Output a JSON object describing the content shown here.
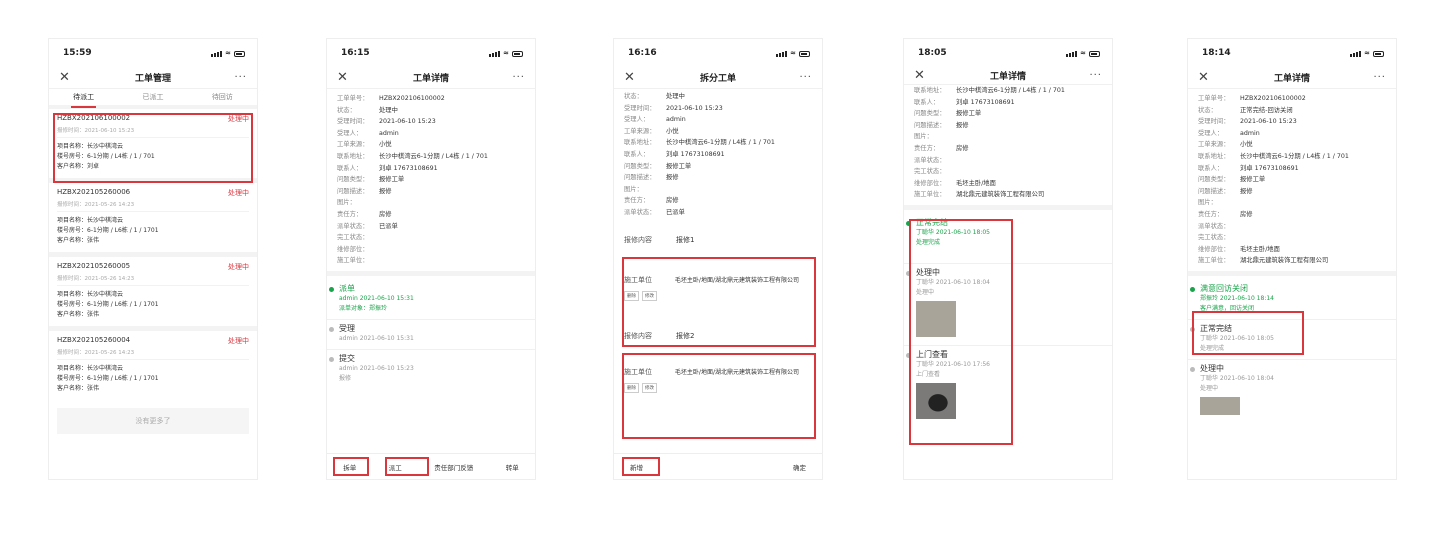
{
  "p1": {
    "time": "15:59",
    "title": "工单管理",
    "tabs": [
      "待派工",
      "已派工",
      "待回访"
    ],
    "cards": [
      {
        "no": "HZBX202106100002",
        "status": "处理中",
        "time": "报修时间：2021-06-10 15:23",
        "project": "项目名称：长沙中棋湾云",
        "room": "楼号房号：6-1分期 / L4栋 / 1 / 701",
        "customer": "客户名称：刘卓"
      },
      {
        "no": "HZBX202105260006",
        "status": "处理中",
        "time": "报修时间：2021-05-26 14:23",
        "project": "项目名称：长沙中棋湾云",
        "room": "楼号房号：6-1分期 / L6栋 / 1 / 1701",
        "customer": "客户名称：张伟"
      },
      {
        "no": "HZBX202105260005",
        "status": "处理中",
        "time": "报修时间：2021-05-26 14:23",
        "project": "项目名称：长沙中棋湾云",
        "room": "楼号房号：6-1分期 / L6栋 / 1 / 1701",
        "customer": "客户名称：张伟"
      },
      {
        "no": "HZBX202105260004",
        "status": "处理中",
        "time": "报修时间：2021-05-26 14:23",
        "project": "项目名称：长沙中棋湾云",
        "room": "楼号房号：6-1分期 / L6栋 / 1 / 1701",
        "customer": "客户名称：张伟"
      }
    ],
    "nomore": "没有更多了"
  },
  "p2": {
    "time": "16:15",
    "title": "工单详情",
    "fields": [
      [
        "工单单号：",
        "HZBX202106100002"
      ],
      [
        "状态：",
        "处理中"
      ],
      [
        "受理时间：",
        "2021-06-10 15:23"
      ],
      [
        "受理人：",
        "admin"
      ],
      [
        "工单来源：",
        "小悦"
      ],
      [
        "联系地址：",
        "长沙中棋湾云6-1分期 / L4栋 / 1 / 701"
      ],
      [
        "联系人：",
        "刘卓 17673108691"
      ],
      [
        "问题类型：",
        "报修工单"
      ],
      [
        "问题描述：",
        "报修"
      ],
      [
        "图片：",
        ""
      ],
      [
        "责任方：",
        "房修"
      ],
      [
        "派单状态：",
        "已派单"
      ],
      [
        "完工状态：",
        ""
      ],
      [
        "维修部位：",
        ""
      ],
      [
        "施工单位：",
        ""
      ]
    ],
    "timeline": [
      {
        "h": "派单",
        "s1": "admin 2021-06-10 15:31",
        "s2": "派单对象：郑振玲"
      },
      {
        "h": "受理",
        "s1": "admin 2021-06-10 15:31",
        "s2": ""
      },
      {
        "h": "提交",
        "s1": "admin 2021-06-10 15:23",
        "s2": "报修"
      }
    ],
    "buttons": [
      "拆单",
      "派工",
      "责任部门反馈",
      "转单"
    ]
  },
  "p3": {
    "time": "16:16",
    "title": "拆分工单",
    "fields": [
      [
        "状态：",
        "处理中"
      ],
      [
        "受理时间：",
        "2021-06-10 15:23"
      ],
      [
        "受理人：",
        "admin"
      ],
      [
        "工单来源：",
        "小悦"
      ],
      [
        "联系地址：",
        "长沙中棋湾云6-1分期 / L4栋 / 1 / 701"
      ],
      [
        "联系人：",
        "刘卓 17673108691"
      ],
      [
        "问题类型：",
        "报修工单"
      ],
      [
        "问题描述：",
        "报修"
      ],
      [
        "图片：",
        ""
      ],
      [
        "责任方：",
        "房修"
      ],
      [
        "派单状态：",
        "已派单"
      ]
    ],
    "blocks": [
      {
        "k1": "报修内容",
        "v1": "报修1",
        "k2": "施工单位",
        "v2": "毛坯主卧/地面/湖北鼎元建筑装饰工程有限公司"
      },
      {
        "k1": "报修内容",
        "v1": "报修2",
        "k2": "施工单位",
        "v2": "毛坯主卧/地面/湖北鼎元建筑装饰工程有限公司"
      }
    ],
    "small_buttons": [
      "删除",
      "修改"
    ],
    "add": "新增",
    "confirm": "确定"
  },
  "p4": {
    "time": "18:05",
    "title": "工单详情",
    "fields": [
      [
        "联系地址：",
        "长沙中棋湾云6-1分期 / L4栋 / 1 / 701"
      ],
      [
        "联系人：",
        "刘卓 17673108691"
      ],
      [
        "问题类型：",
        "报修工单"
      ],
      [
        "问题描述：",
        "报修"
      ],
      [
        "图片：",
        ""
      ],
      [
        "责任方：",
        "房修"
      ],
      [
        "派单状态：",
        ""
      ],
      [
        "完工状态：",
        ""
      ],
      [
        "维修部位：",
        "毛坯主卧/地面"
      ],
      [
        "施工单位：",
        "湖北鼎元建筑装饰工程有限公司"
      ]
    ],
    "timeline": [
      {
        "h": "正常完结",
        "s1": "丁聪华 2021-06-10 18:05",
        "s2": "处理完成"
      },
      {
        "h": "处理中",
        "s1": "丁聪华 2021-06-10 18:04",
        "s2": "处理中"
      },
      {
        "h": "上门查看",
        "s1": "丁聪华 2021-06-10 17:56",
        "s2": "上门查看"
      }
    ]
  },
  "p5": {
    "time": "18:14",
    "title": "工单详情",
    "fields": [
      [
        "工单单号：",
        "HZBX202106100002"
      ],
      [
        "状态：",
        "正常完结-回访关闭"
      ],
      [
        "受理时间：",
        "2021-06-10 15:23"
      ],
      [
        "受理人：",
        "admin"
      ],
      [
        "工单来源：",
        "小悦"
      ],
      [
        "联系地址：",
        "长沙中棋湾云6-1分期 / L4栋 / 1 / 701"
      ],
      [
        "联系人：",
        "刘卓 17673108691"
      ],
      [
        "问题类型：",
        "报修工单"
      ],
      [
        "问题描述：",
        "报修"
      ],
      [
        "图片：",
        ""
      ],
      [
        "责任方：",
        "房修"
      ],
      [
        "派单状态：",
        ""
      ],
      [
        "完工状态：",
        ""
      ],
      [
        "维修部位：",
        "毛坯主卧/地面"
      ],
      [
        "施工单位：",
        "湖北鼎元建筑装饰工程有限公司"
      ]
    ],
    "timeline": [
      {
        "h": "满意回访关闭",
        "s1": "郑振玲 2021-06-10 18:14",
        "s2": "客户满意，回访关闭"
      },
      {
        "h": "正常完结",
        "s1": "丁聪华 2021-06-10 18:05",
        "s2": "处理完成"
      },
      {
        "h": "处理中",
        "s1": "丁聪华 2021-06-10 18:04",
        "s2": "处理中"
      }
    ]
  }
}
